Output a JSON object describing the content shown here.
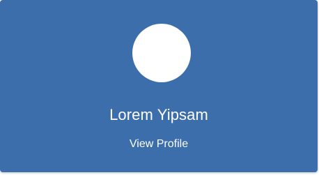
{
  "profile_card": {
    "name": "Lorem Yipsam",
    "link_label": "View Profile",
    "avatar_icon": "avatar-circle",
    "background_color": "#3b6eab",
    "text_color": "#ffffff"
  }
}
